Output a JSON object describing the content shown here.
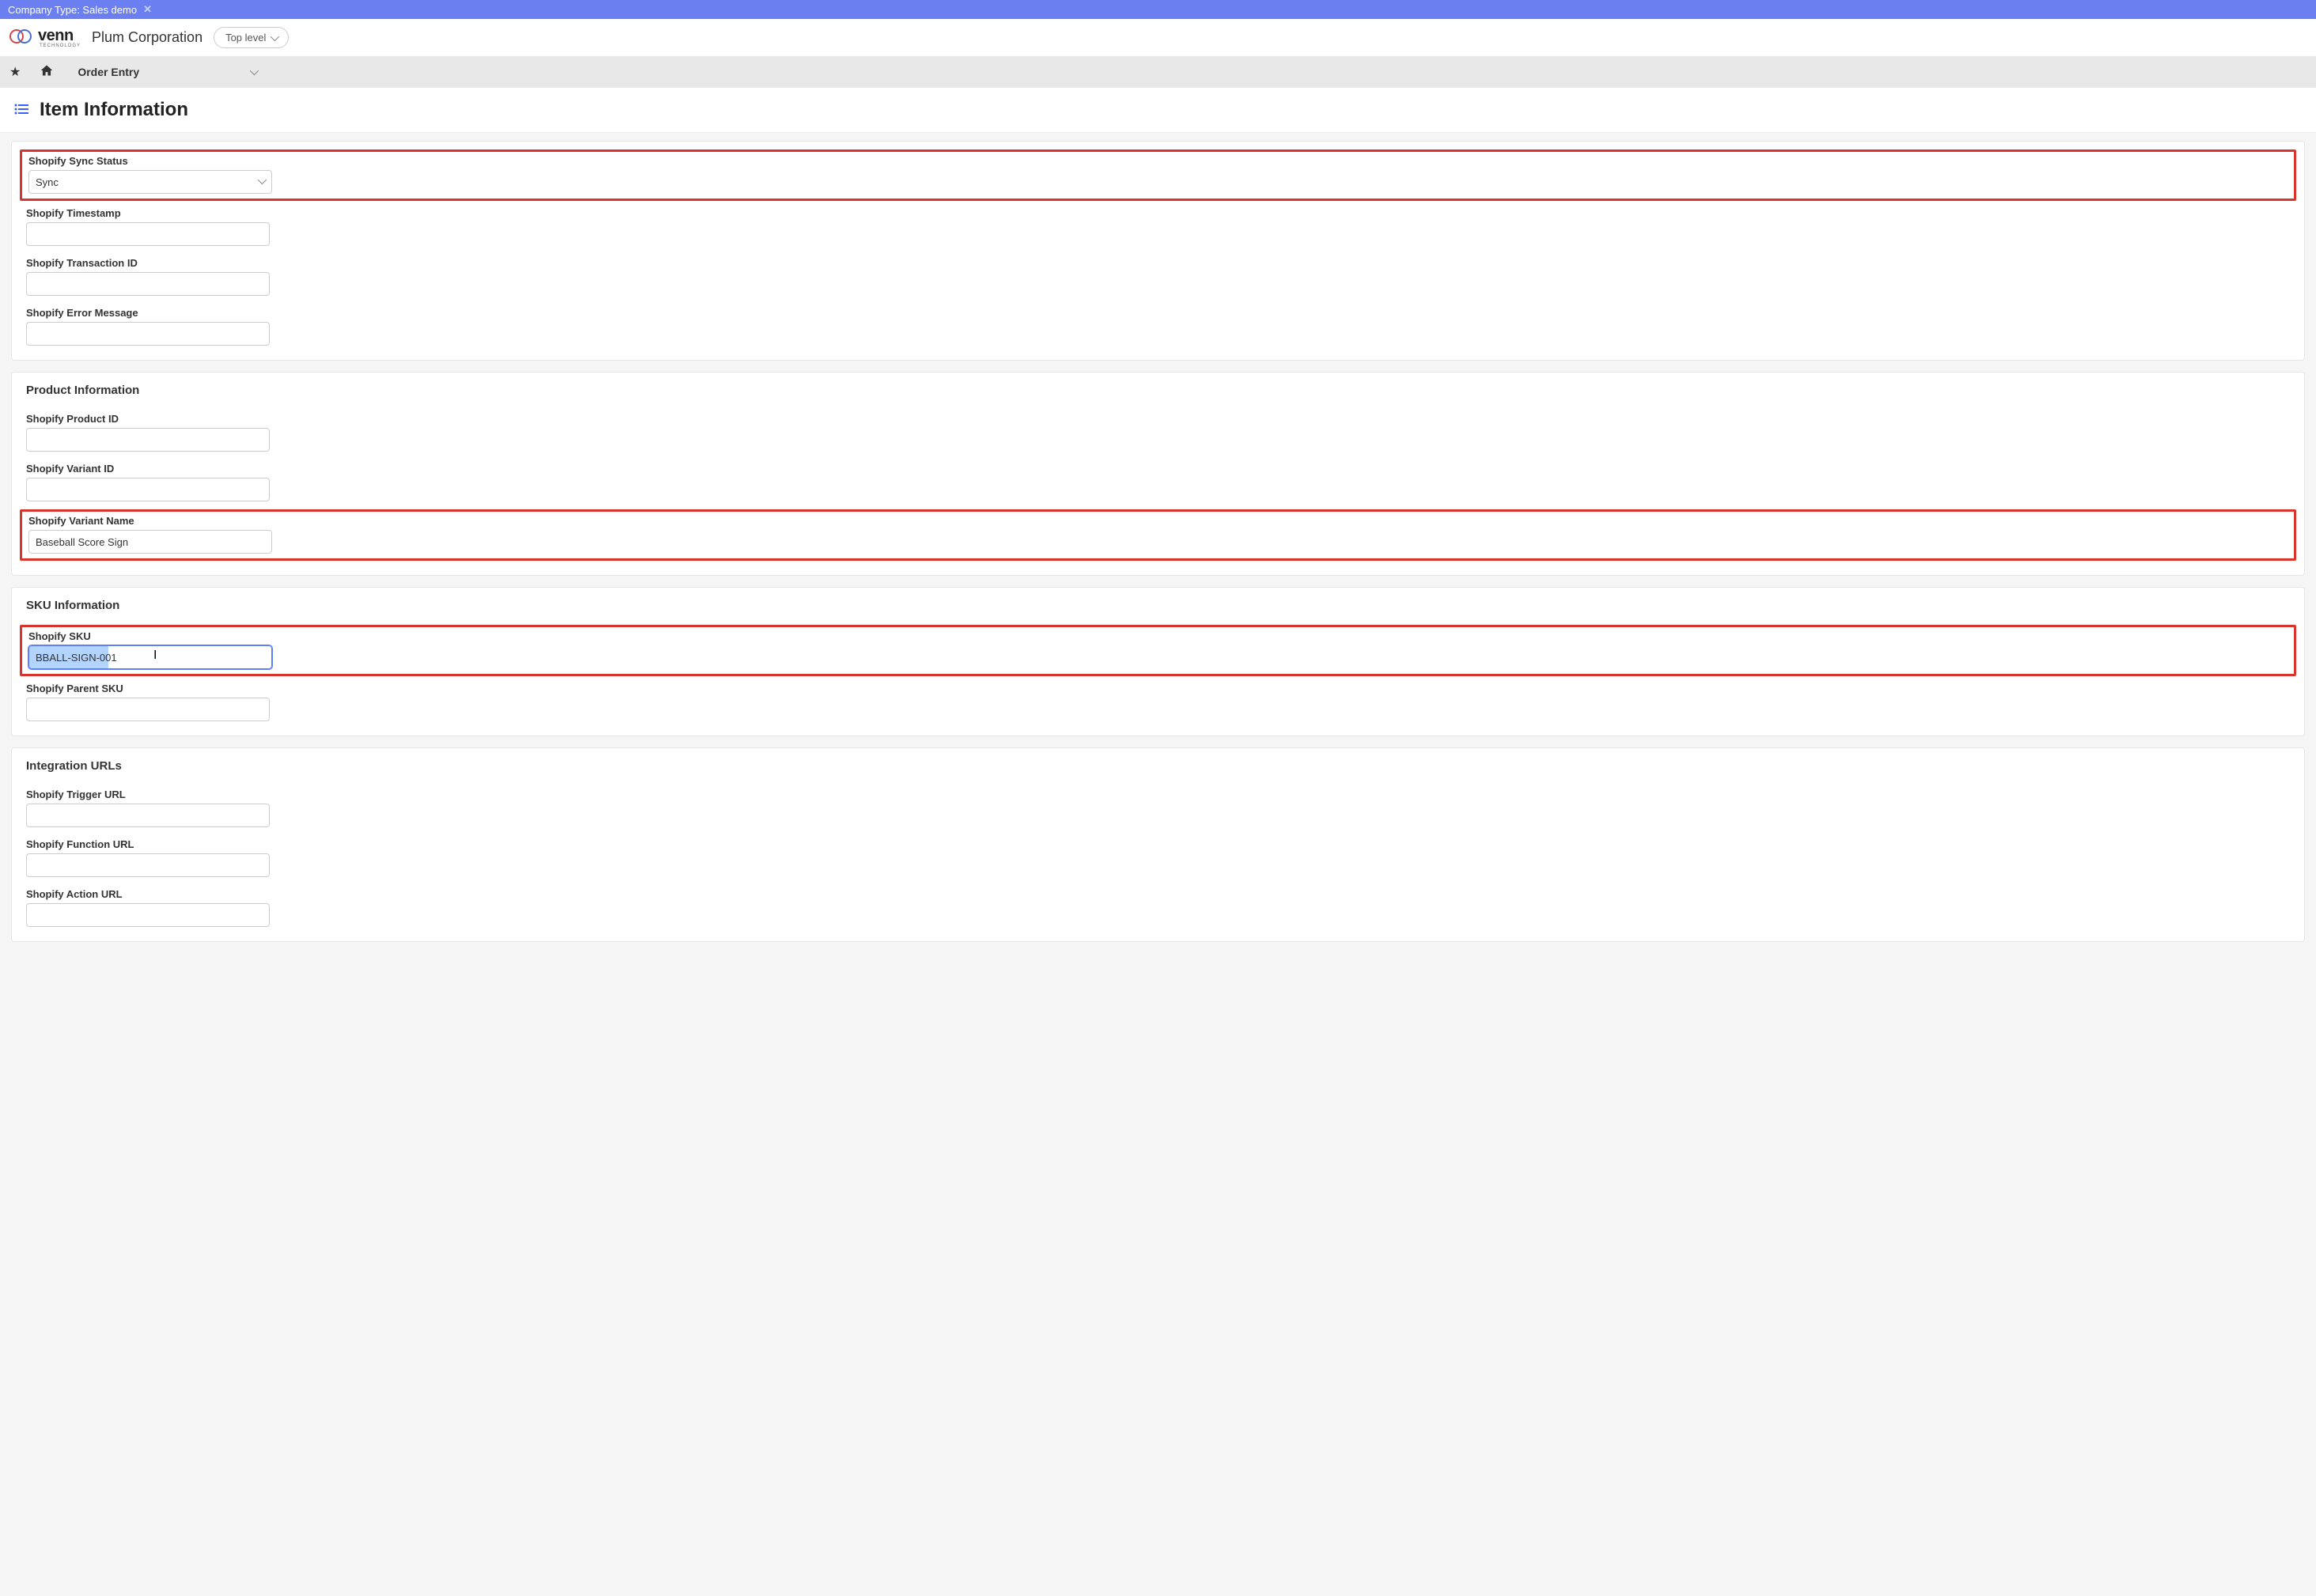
{
  "banner": {
    "text": "Company Type: Sales demo"
  },
  "header": {
    "logo_text": "venn",
    "logo_sub": "TECHNOLOGY",
    "company": "Plum Corporation",
    "top_level_label": "Top level"
  },
  "nav": {
    "menu_item": "Order Entry"
  },
  "page": {
    "title": "Item Information"
  },
  "sync_section": {
    "status_label": "Shopify Sync Status",
    "status_value": "Sync",
    "timestamp_label": "Shopify Timestamp",
    "timestamp_value": "",
    "transaction_label": "Shopify Transaction ID",
    "transaction_value": "",
    "error_label": "Shopify Error Message",
    "error_value": ""
  },
  "product_section": {
    "heading": "Product Information",
    "product_id_label": "Shopify Product ID",
    "product_id_value": "",
    "variant_id_label": "Shopify Variant ID",
    "variant_id_value": "",
    "variant_name_label": "Shopify Variant Name",
    "variant_name_value": "Baseball Score Sign"
  },
  "sku_section": {
    "heading": "SKU Information",
    "sku_label": "Shopify SKU",
    "sku_value": "BBALL-SIGN-001",
    "parent_sku_label": "Shopify Parent SKU",
    "parent_sku_value": ""
  },
  "urls_section": {
    "heading": "Integration URLs",
    "trigger_label": "Shopify Trigger URL",
    "trigger_value": "",
    "function_label": "Shopify Function URL",
    "function_value": "",
    "action_label": "Shopify Action URL",
    "action_value": ""
  }
}
